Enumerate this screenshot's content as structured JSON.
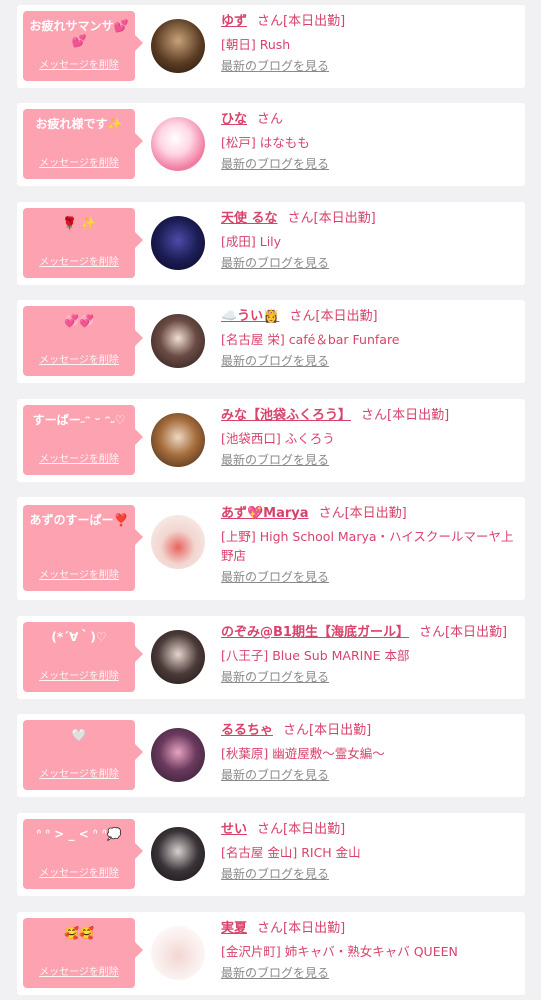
{
  "delete_label": "メッセージを削除",
  "blog_label": "最新のブログを見る",
  "san_label": "さん",
  "colors": {
    "accent": "#d8436b",
    "bubble": "#fca2b0",
    "background": "#f1f1f4"
  },
  "items": [
    {
      "message": "お疲れサマンサ💕\n💕",
      "name": "ゆず",
      "status": "[本日出勤]",
      "shop": "[朝日] Rush"
    },
    {
      "message": "お疲れ様です✨",
      "name": "ひな",
      "status": "",
      "shop": "[松戸] はなもも"
    },
    {
      "message": "🌹 ✨",
      "name": "天使 るな",
      "status": "[本日出勤]",
      "shop": "[成田] Lily"
    },
    {
      "message": "💞💞",
      "name": "☁️うい👸",
      "status": "[本日出勤]",
      "shop": "[名古屋 栄] café＆bar Funfare"
    },
    {
      "message": "すーぱー˶ᵔ ᵕ ᵔ˶♡",
      "name": "みな【池袋ふくろう】",
      "status": "[本日出勤]",
      "shop": "[池袋西口] ふくろう"
    },
    {
      "message": "あずのすーぱー❣️",
      "name": "あず💖Marya",
      "status": "[本日出勤]",
      "shop": "[上野] High School Marya・ハイスクールマーヤ上野店"
    },
    {
      "message": "(*´∀｀)♡",
      "name": "のぞみ@B1期生【海底ガール】",
      "status": "[本日出勤]",
      "shop": "[八王子] Blue Sub MARINE 本部"
    },
    {
      "message": "🤍",
      "name": "るるちゃ",
      "status": "[本日出勤]",
      "shop": "[秋葉原] 幽遊屋敷〜霊女編〜"
    },
    {
      "message": "ᐢ ᐢ > _ < ᐢ ᐢ💭",
      "name": "せい",
      "status": "[本日出勤]",
      "shop": "[名古屋 金山] RICH 金山"
    },
    {
      "message": "🥰🥰",
      "name": "実夏",
      "status": "[本日出勤]",
      "shop": "[金沢片町] 姉キャバ・熟女キャバ QUEEN"
    }
  ]
}
